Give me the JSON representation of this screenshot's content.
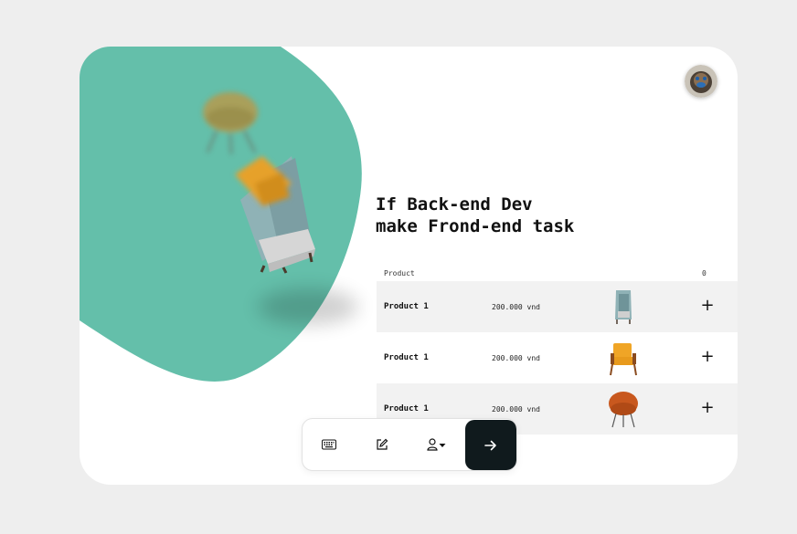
{
  "hero": {
    "line1": "If Back-end Dev",
    "line2": "make Frond-end task",
    "blob_color": "#64bfaa"
  },
  "table": {
    "header_product": "Product",
    "header_count": "0",
    "rows": [
      {
        "name": "Product 1",
        "price": "200.000 vnd",
        "image": "booth-chair-icon",
        "add": "+"
      },
      {
        "name": "Product 1",
        "price": "200.000 vnd",
        "image": "armchair-icon",
        "add": "+"
      },
      {
        "name": "Product 1",
        "price": "200.000 vnd",
        "image": "egg-chair-icon",
        "add": "+"
      }
    ]
  },
  "toolbar": {
    "items": [
      "keyboard-icon",
      "edit-icon",
      "user-dropdown-icon",
      "arrow-right-icon"
    ],
    "accent": "#101a1d"
  },
  "avatar": {
    "image": "avatar-icon"
  }
}
